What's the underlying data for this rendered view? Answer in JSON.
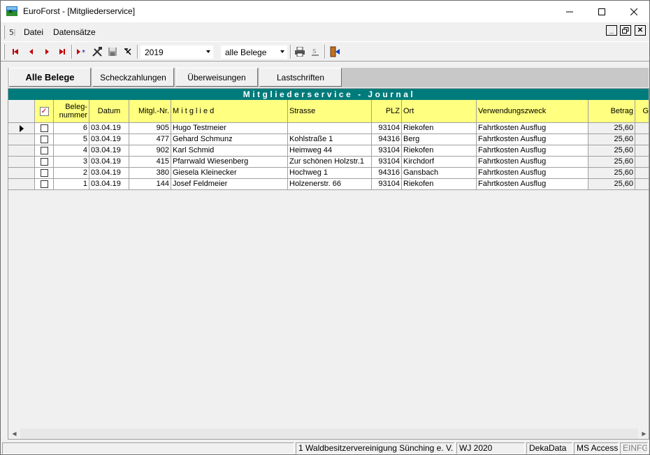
{
  "window": {
    "title": "EuroForst - [Mitgliederservice]",
    "minimize": "—",
    "maximize": "☐",
    "close": "✕"
  },
  "menu": {
    "items": [
      "Datei",
      "Datensätze"
    ]
  },
  "toolbar": {
    "year_value": "2019",
    "filter_value": "alle Belege"
  },
  "tabs": [
    {
      "label": "Alle Belege",
      "active": true
    },
    {
      "label": "Scheckzahlungen",
      "active": false
    },
    {
      "label": "Überweisungen",
      "active": false
    },
    {
      "label": "Lastschriften",
      "active": false
    }
  ],
  "grid": {
    "title": "Mitgliederservice - Journal",
    "headers": {
      "belegnummer": "Beleg-\nnummer",
      "datum": "Datum",
      "mitgl_nr": "Mitgl.-Nr.",
      "mitglied": "M i t g l i e d",
      "strasse": "Strasse",
      "plz": "PLZ",
      "ort": "Ort",
      "verwendungszweck": "Verwendungszweck",
      "betrag": "Betrag",
      "extra": "G"
    },
    "rows": [
      {
        "nr": "6",
        "datum": "03.04.19",
        "mitgl": "905",
        "name": "Hugo Testmeier",
        "strasse": "",
        "plz": "93104",
        "ort": "Riekofen",
        "zweck": "Fahrtkosten Ausflug",
        "betrag": "25,60",
        "current": true
      },
      {
        "nr": "5",
        "datum": "03.04.19",
        "mitgl": "477",
        "name": "Gehard Schmunz",
        "strasse": "Kohlstraße 1",
        "plz": "94316",
        "ort": "Berg",
        "zweck": "Fahrtkosten Ausflug",
        "betrag": "25,60",
        "current": false
      },
      {
        "nr": "4",
        "datum": "03.04.19",
        "mitgl": "902",
        "name": "Karl Schmid",
        "strasse": "Heimweg 44",
        "plz": "93104",
        "ort": "Riekofen",
        "zweck": "Fahrtkosten Ausflug",
        "betrag": "25,60",
        "current": false
      },
      {
        "nr": "3",
        "datum": "03.04.19",
        "mitgl": "415",
        "name": "Pfarrwald Wiesenberg",
        "strasse": "Zur schönen Holzstr.1",
        "plz": "93104",
        "ort": "Kirchdorf",
        "zweck": "Fahrtkosten Ausflug",
        "betrag": "25,60",
        "current": false
      },
      {
        "nr": "2",
        "datum": "03.04.19",
        "mitgl": "380",
        "name": "Giesela Kleinecker",
        "strasse": "Hochweg 1",
        "plz": "94316",
        "ort": "Gansbach",
        "zweck": "Fahrtkosten Ausflug",
        "betrag": "25,60",
        "current": false
      },
      {
        "nr": "1",
        "datum": "03.04.19",
        "mitgl": "144",
        "name": "Josef Feldmeier",
        "strasse": "Holzenerstr. 66",
        "plz": "93104",
        "ort": "Riekofen",
        "zweck": "Fahrtkosten Ausflug",
        "betrag": "25,60",
        "current": false
      }
    ]
  },
  "statusbar": {
    "org": "1 Waldbesitzervereinigung Sünching e. V.",
    "year": "WJ 2020",
    "vendor": "DekaData",
    "db": "MS Access",
    "mode": "EINFG"
  },
  "colors": {
    "title_band": "#007b7b",
    "header_bg": "#ffff80"
  }
}
